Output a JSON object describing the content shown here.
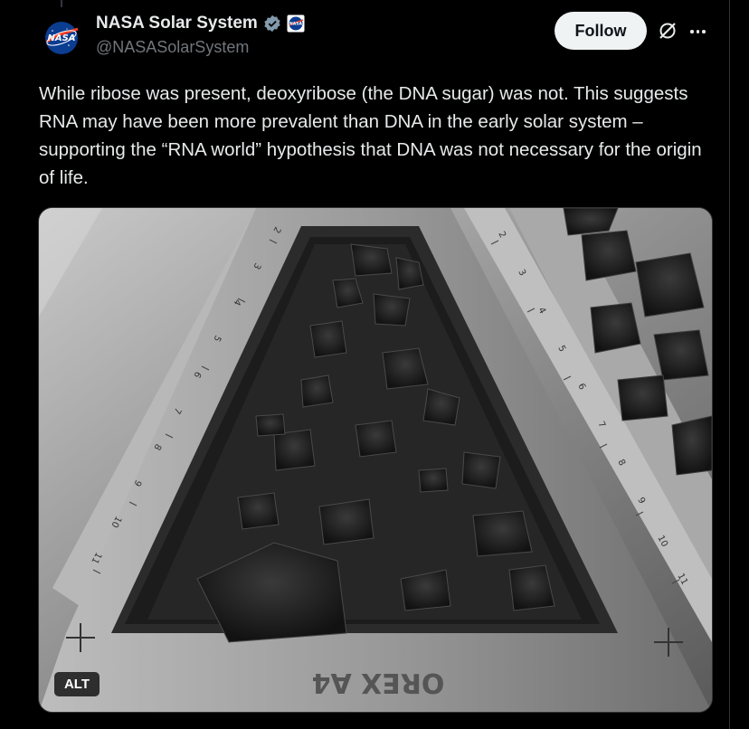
{
  "author": {
    "name": "NASA Solar System",
    "handle": "@NASASolarSystem",
    "avatar_icon": "nasa-meatball-logo",
    "verified_icon": "verified-badge-icon",
    "affiliation_icon": "nasa-affiliation-badge"
  },
  "actions": {
    "follow_label": "Follow",
    "grok_icon": "grok-icon",
    "more_icon": "more-icon"
  },
  "post": {
    "text": "While ribose was present, deoxyribose (the DNA sugar) was not. This suggests RNA may have been more prevalent than DNA in the early solar system – supporting the “RNA world” hypothesis that DNA was not necessary for the origin of life."
  },
  "media": {
    "description_icon": "asteroid-sample-tray-photo",
    "alt_label": "ALT",
    "tray_label": "OREX A4",
    "ruler_numbers_left": [
      "2",
      "3",
      "4",
      "5",
      "6",
      "7",
      "8",
      "9",
      "10",
      "11"
    ],
    "ruler_numbers_right": [
      "2",
      "3",
      "4",
      "5",
      "6",
      "7",
      "8",
      "9",
      "10",
      "11"
    ]
  },
  "colors": {
    "background": "#000000",
    "text": "#e7e9ea",
    "secondary_text": "#71767b",
    "follow_bg": "#eff3f4",
    "verified": "#1d9bf0"
  }
}
